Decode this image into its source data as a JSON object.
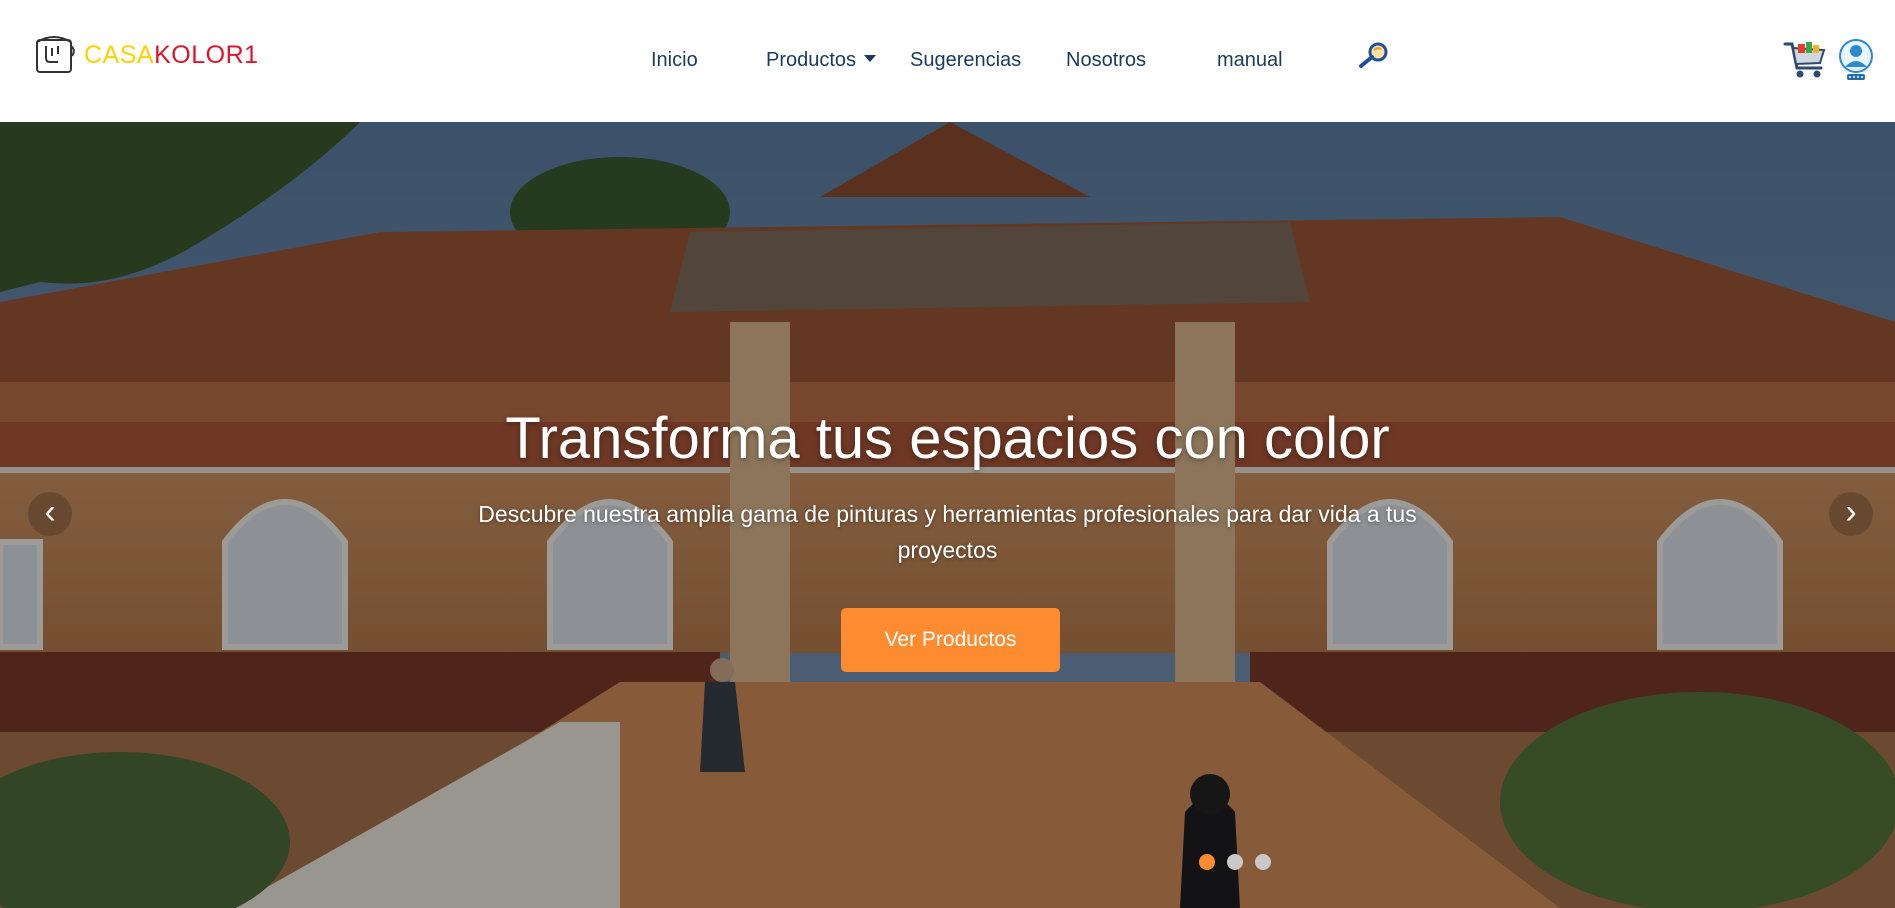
{
  "brand": {
    "name_part_a": "CASA",
    "name_part_b": "KOLOR1",
    "logo_icon": "paint-bucket-icon",
    "color_part_a": "#ffd100",
    "color_part_b": "#e3122b"
  },
  "nav": {
    "items": [
      {
        "label": "Inicio"
      },
      {
        "label": "Productos",
        "has_dropdown": true
      },
      {
        "label": "Sugerencias"
      },
      {
        "label": "Nosotros"
      },
      {
        "label": "manual"
      }
    ],
    "link_color": "#1a3a5e",
    "search_icon": "magnifier-icon",
    "cart_icon": "shopping-cart-icon",
    "user_icon": "user-avatar-icon"
  },
  "hero": {
    "title": "Transforma tus espacios con color",
    "subtitle": "Descubre nuestra amplia gama de pinturas y herramientas profesionales para dar vida a tus proyectos",
    "cta_label": "Ver Productos",
    "cta_color": "#fd8b2f",
    "prev_label": "‹",
    "next_label": "›",
    "slides_count": 3,
    "active_slide": 1
  }
}
